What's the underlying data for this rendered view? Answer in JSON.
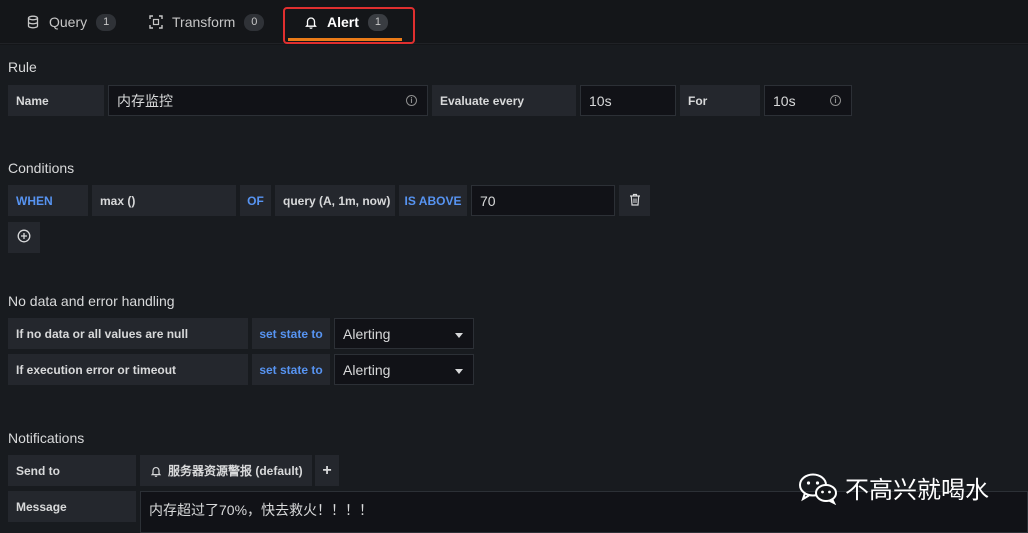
{
  "tabs": [
    {
      "label": "Query",
      "count": "1"
    },
    {
      "label": "Transform",
      "count": "0"
    },
    {
      "label": "Alert",
      "count": "1"
    }
  ],
  "rule": {
    "title": "Rule",
    "name_label": "Name",
    "name_value": "内存监控",
    "evaluate_label": "Evaluate every",
    "evaluate_value": "10s",
    "for_label": "For",
    "for_value": "10s"
  },
  "conditions": {
    "title": "Conditions",
    "when": "WHEN",
    "reducer": "max ()",
    "of": "OF",
    "query": "query (A, 1m, now)",
    "evaluator": "IS ABOVE",
    "threshold": "70"
  },
  "nodata": {
    "title": "No data and error handling",
    "rows": [
      {
        "label": "If no data or all values are null",
        "action": "set state to",
        "value": "Alerting"
      },
      {
        "label": "If execution error or timeout",
        "action": "set state to",
        "value": "Alerting"
      }
    ]
  },
  "notifications": {
    "title": "Notifications",
    "send_to_label": "Send to",
    "channel": "服务器资源警报 (default)",
    "add_label": "+",
    "message_label": "Message",
    "message_value": "内存超过了70%，快去救火！！！！"
  },
  "watermark": "不高兴就喝水",
  "colors": {
    "accent": "#eb7b18",
    "keyword": "#5794f2",
    "highlight": "#e02f2f"
  }
}
